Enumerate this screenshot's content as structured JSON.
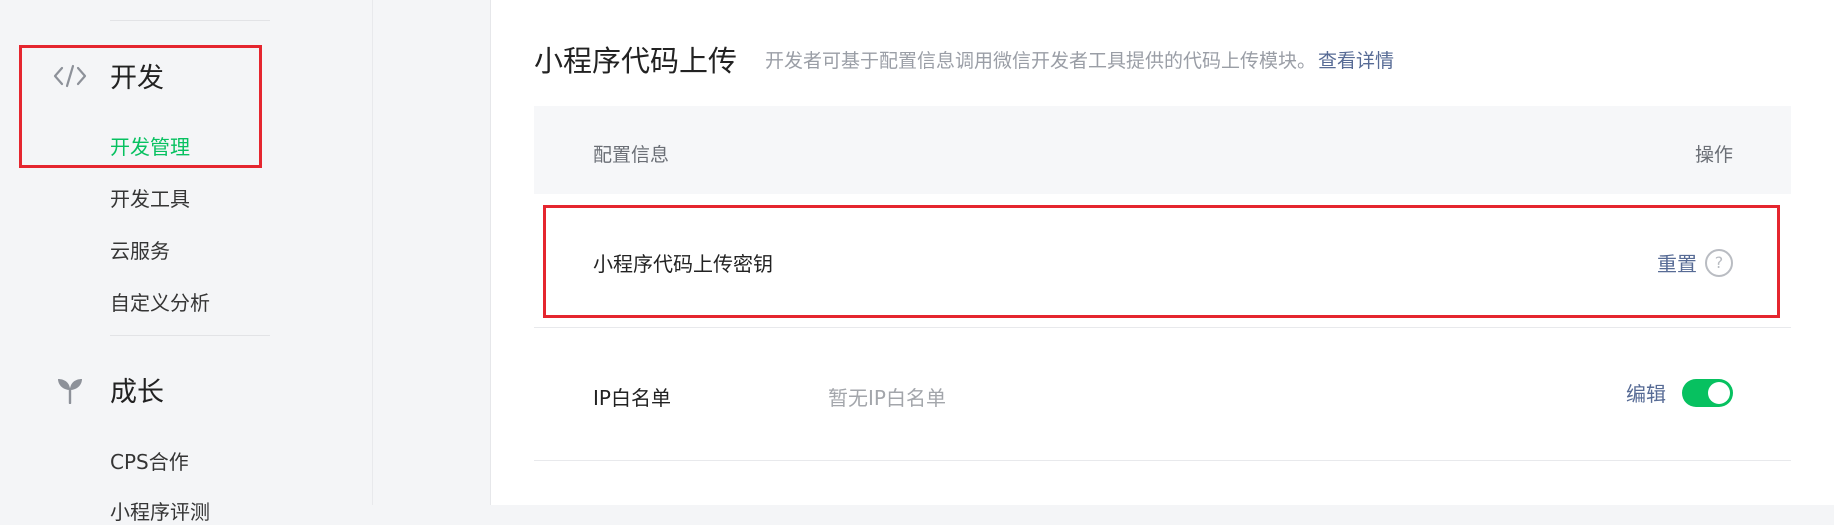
{
  "sidebar": {
    "sections": [
      {
        "title": "开发",
        "icon": "code-icon",
        "items": [
          {
            "label": "开发管理",
            "active": true
          },
          {
            "label": "开发工具",
            "active": false
          },
          {
            "label": "云服务",
            "active": false
          },
          {
            "label": "自定义分析",
            "active": false
          }
        ]
      },
      {
        "title": "成长",
        "icon": "sprout-icon",
        "items": [
          {
            "label": "CPS合作",
            "active": false
          },
          {
            "label": "小程序评测",
            "active": false
          }
        ]
      }
    ]
  },
  "main": {
    "title": "小程序代码上传",
    "description": "开发者可基于配置信息调用微信开发者工具提供的代码上传模块。",
    "details_link": "查看详情",
    "table": {
      "headers": {
        "config": "配置信息",
        "action": "操作"
      },
      "rows": [
        {
          "label": "小程序代码上传密钥",
          "value": "",
          "action": "重置",
          "help": "?"
        },
        {
          "label": "IP白名单",
          "value": "暂无IP白名单",
          "action": "编辑",
          "toggle_on": true
        }
      ]
    }
  },
  "colors": {
    "accent": "#07c160",
    "link": "#576b95",
    "highlight": "#e5262f"
  }
}
